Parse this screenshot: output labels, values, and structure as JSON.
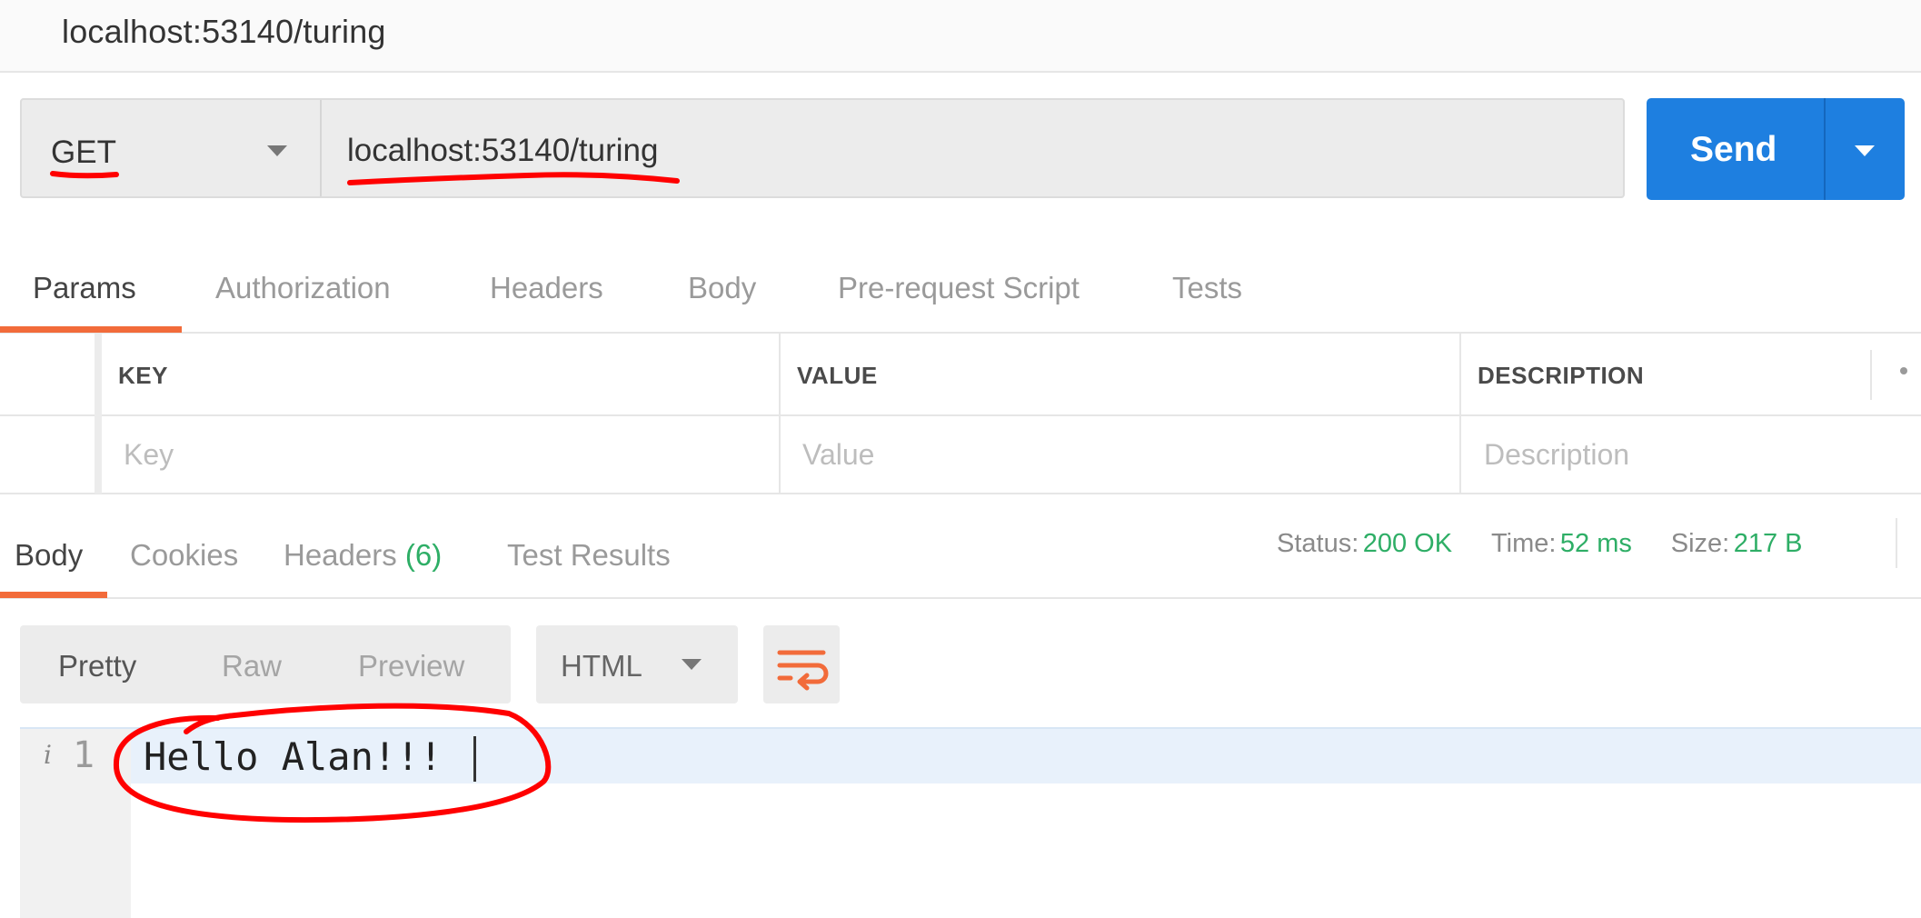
{
  "window": {
    "title": "localhost:53140/turing"
  },
  "request": {
    "method": "GET",
    "url": "localhost:53140/turing",
    "send_label": "Send"
  },
  "request_tabs": [
    "Params",
    "Authorization",
    "Headers",
    "Body",
    "Pre-request Script",
    "Tests"
  ],
  "params": {
    "headers": [
      "KEY",
      "VALUE",
      "DESCRIPTION"
    ],
    "more_icon": "dots-icon",
    "row_placeholders": [
      "Key",
      "Value",
      "Description"
    ]
  },
  "response_tabs": {
    "body": "Body",
    "cookies": "Cookies",
    "headers": "Headers",
    "headers_count": "(6)",
    "test_results": "Test Results"
  },
  "status": {
    "status_label": "Status:",
    "status_value": "200 OK",
    "time_label": "Time:",
    "time_value": "52 ms",
    "size_label": "Size:",
    "size_value": "217 B"
  },
  "response_view": {
    "modes": [
      "Pretty",
      "Raw",
      "Preview"
    ],
    "format": "HTML",
    "wrap_icon": "wrap-lines-icon"
  },
  "editor": {
    "info_icon": "i",
    "line_number": "1",
    "line_text": "Hello Alan!!!"
  },
  "colors": {
    "send_button": "#1e7fe0",
    "active_tab_underline": "#f26b3a",
    "status_ok": "#2eae66",
    "annotation_red": "#ff0000"
  }
}
